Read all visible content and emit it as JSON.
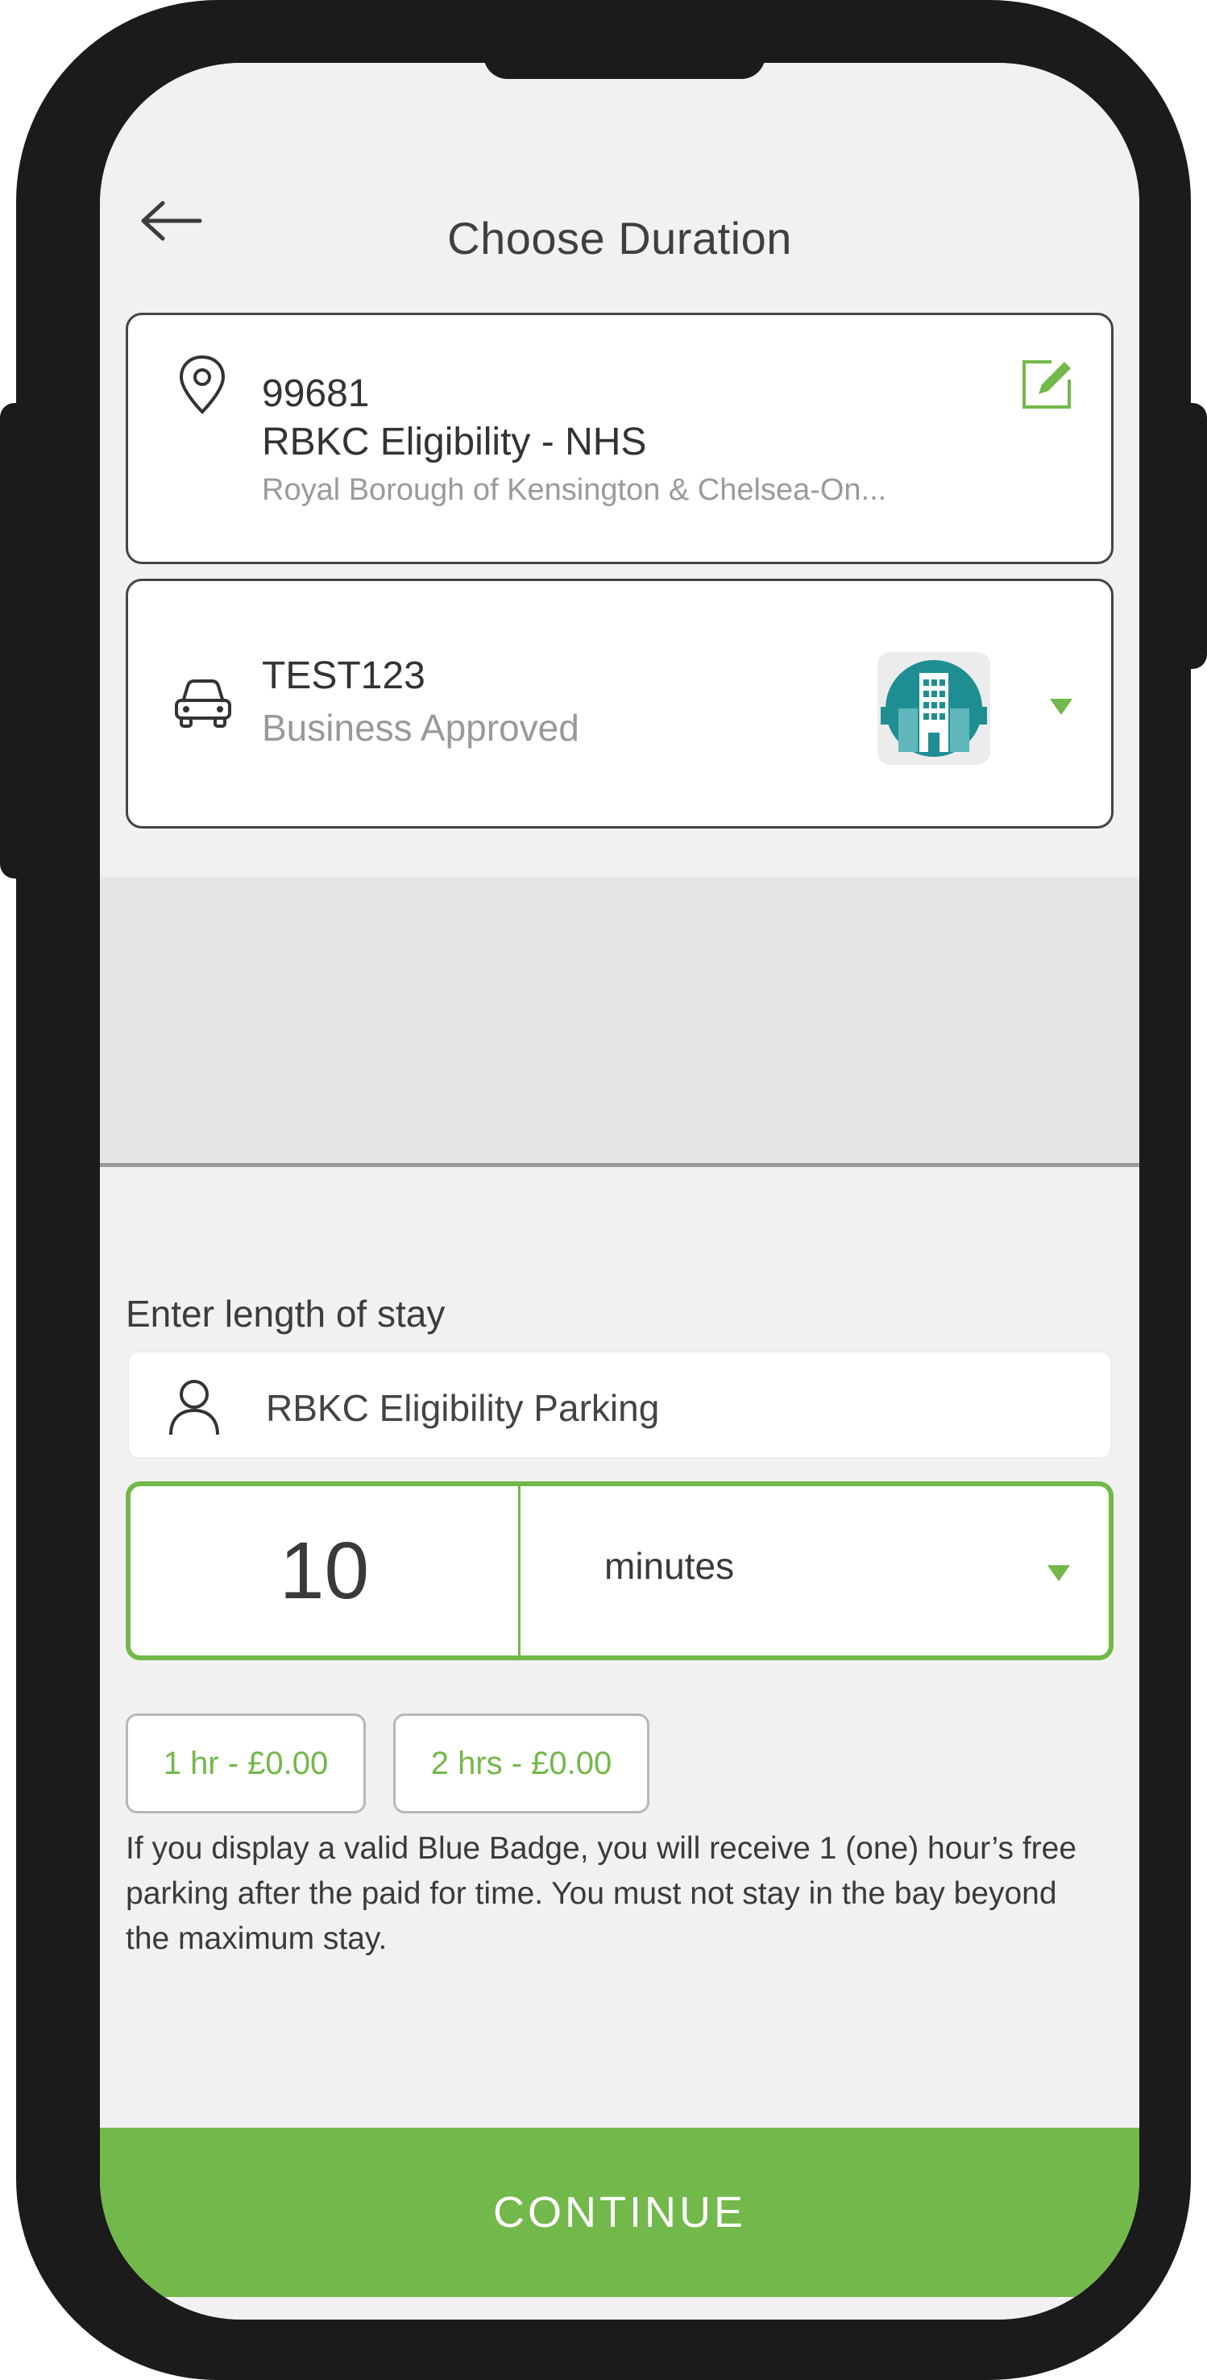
{
  "header": {
    "title": "Choose Duration",
    "back_icon": "arrow-left-icon"
  },
  "location": {
    "code": "99681",
    "name": "RBKC Eligibility - NHS",
    "area": "Royal Borough of Kensington & Chelsea-On...",
    "pin_icon": "location-pin-icon",
    "edit_icon": "edit-icon"
  },
  "vehicle": {
    "registration": "TEST123",
    "status": "Business Approved",
    "car_icon": "car-icon",
    "badge_icon": "business-building-icon"
  },
  "stay": {
    "label": "Enter length of stay",
    "zone": "RBKC Eligibility Parking",
    "duration_value": "10",
    "duration_unit": "minutes"
  },
  "quick_options": [
    "1 hr - £0.00",
    "2 hrs - £0.00"
  ],
  "notice": "If you display a valid Blue Badge, you will receive 1 (one) hour’s free parking after the paid for time. You must not stay in the bay beyond the maximum stay.",
  "continue_label": "CONTINUE",
  "colors": {
    "accent": "#72b84a",
    "badge_teal": "#1f8e93",
    "text": "#3a3a3a"
  }
}
